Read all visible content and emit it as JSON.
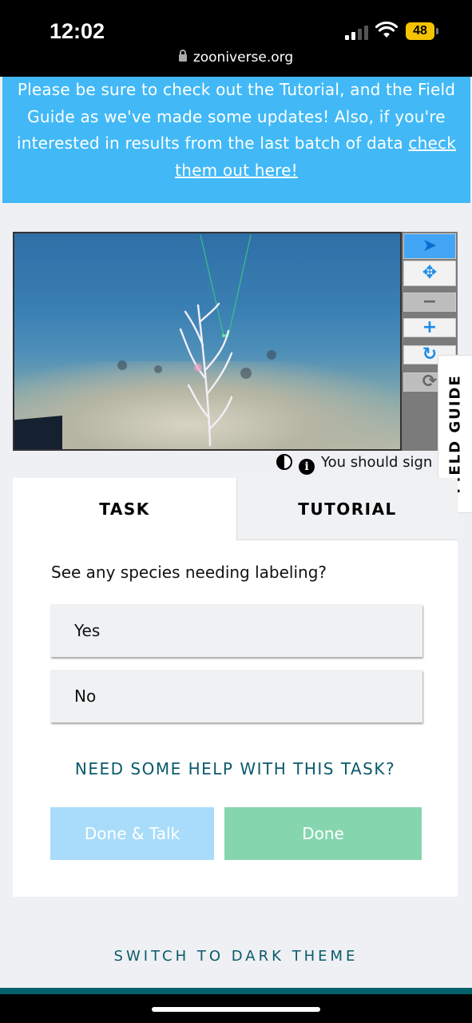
{
  "status_bar": {
    "time": "12:02",
    "battery": "48",
    "url": "zooniverse.org"
  },
  "banner": {
    "text": "Please be sure to check out the Tutorial, and the Field Guide as we've made some updates! Also, if you're interested in results from the last batch of data ",
    "link": "check them out here!"
  },
  "toolbar": {
    "tools": [
      {
        "name": "pointer-icon",
        "glyph": "➤"
      },
      {
        "name": "move-icon",
        "glyph": "✥"
      },
      {
        "name": "zoom-out-icon",
        "glyph": "−"
      },
      {
        "name": "zoom-in-icon",
        "glyph": "+"
      },
      {
        "name": "rotate-icon",
        "glyph": "↻"
      },
      {
        "name": "reset-icon",
        "glyph": "⟳"
      }
    ]
  },
  "field_guide": {
    "label": "FIELD GUIDE"
  },
  "subject_meta": {
    "sign_in_note": "You should sign in"
  },
  "task": {
    "tabs": {
      "task": "TASK",
      "tutorial": "TUTORIAL"
    },
    "question": "See any species needing labeling?",
    "answers": [
      "Yes",
      "No"
    ],
    "help": "NEED SOME HELP WITH THIS TASK?",
    "done_talk": "Done & Talk",
    "done": "Done"
  },
  "theme_switch": "SWITCH TO DARK THEME",
  "colors": {
    "banner": "#42b9f6",
    "done_talk": "#a8dcfa",
    "done": "#85d6ae",
    "teal_text": "#0a5a6b"
  }
}
